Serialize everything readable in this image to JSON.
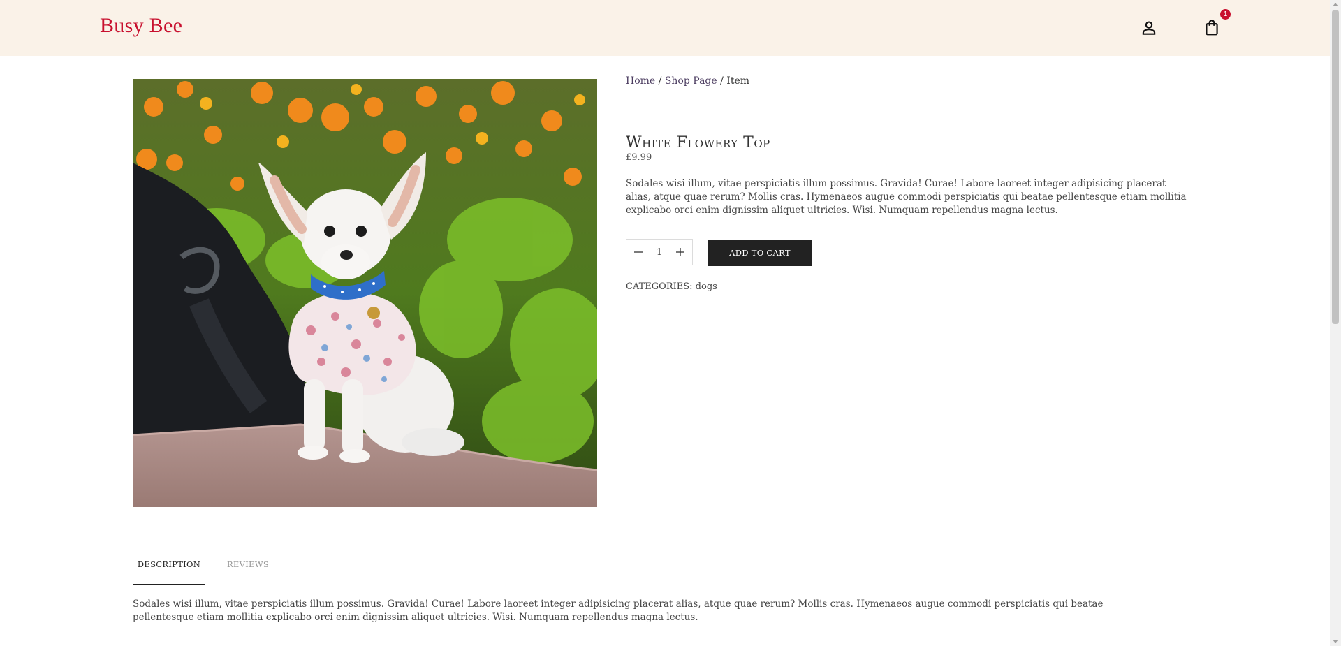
{
  "header": {
    "logo": "Busy Bee",
    "account_icon": "person-icon",
    "cart_icon": "shopping-bag-icon",
    "cart_count": "1"
  },
  "breadcrumb": {
    "home": "Home",
    "sep1": " / ",
    "shop": "Shop Page",
    "sep2": " / ",
    "current": "Item"
  },
  "product": {
    "title": "White Flowery Top",
    "price": "£9.99",
    "short_description": "Sodales wisi illum, vitae perspiciatis illum possimus. Gravida! Curae! Labore laoreet integer adipisicing placerat alias, atque quae rerum? Mollis cras. Hymenaeos augue commodi perspiciatis qui beatae pellentesque etiam mollitia explicabo orci enim dignissim aliquet ultricies. Wisi. Numquam repellendus magna lectus.",
    "quantity": "1",
    "add_to_cart": "ADD TO CART",
    "categories_label": "CATEGORIES:",
    "category": "dogs"
  },
  "tabs": [
    {
      "label": "DESCRIPTION",
      "active": true
    },
    {
      "label": "REVIEWS",
      "active": false
    }
  ],
  "description": "Sodales wisi illum, vitae perspiciatis illum possimus. Gravida! Curae! Labore laoreet integer adipisicing placerat alias, atque quae rerum? Mollis cras. Hymenaeos augue commodi perspiciatis qui beatae pellentesque etiam mollitia explicabo orci enim dignissim aliquet ultricies. Wisi. Numquam repellendus magna lectus.",
  "colors": {
    "header_bg": "#faf2e8",
    "brand": "#c8102e",
    "button_bg": "#222222"
  }
}
